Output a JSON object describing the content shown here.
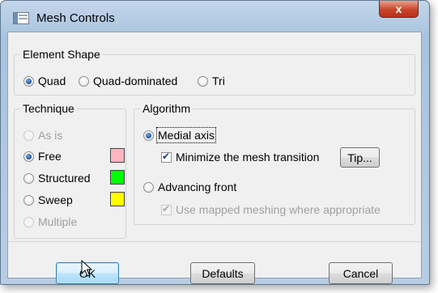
{
  "window": {
    "title": "Mesh Controls",
    "close_glyph": "x"
  },
  "element_shape": {
    "legend": "Element Shape",
    "options": [
      {
        "label": "Quad",
        "selected": true
      },
      {
        "label": "Quad-dominated",
        "selected": false
      },
      {
        "label": "Tri",
        "selected": false
      }
    ]
  },
  "technique": {
    "legend": "Technique",
    "options": [
      {
        "label": "As is",
        "selected": false,
        "enabled": false
      },
      {
        "label": "Free",
        "selected": true,
        "enabled": true,
        "color": "#ffb6c1"
      },
      {
        "label": "Structured",
        "selected": false,
        "enabled": true,
        "color": "#00ff00"
      },
      {
        "label": "Sweep",
        "selected": false,
        "enabled": true,
        "color": "#ffff00"
      },
      {
        "label": "Multiple",
        "selected": false,
        "enabled": false
      }
    ]
  },
  "algorithm": {
    "legend": "Algorithm",
    "medial_axis": "Medial axis",
    "minimize_transition": "Minimize the mesh transition",
    "tip_button": "Tip...",
    "advancing_front": "Advancing front",
    "mapped_meshing": "Use mapped meshing where appropriate"
  },
  "buttons": {
    "ok": "OK",
    "defaults": "Defaults",
    "cancel": "Cancel"
  },
  "icons": {
    "window_icon": "window-icon",
    "cursor": "mouse-pointer-icon"
  }
}
